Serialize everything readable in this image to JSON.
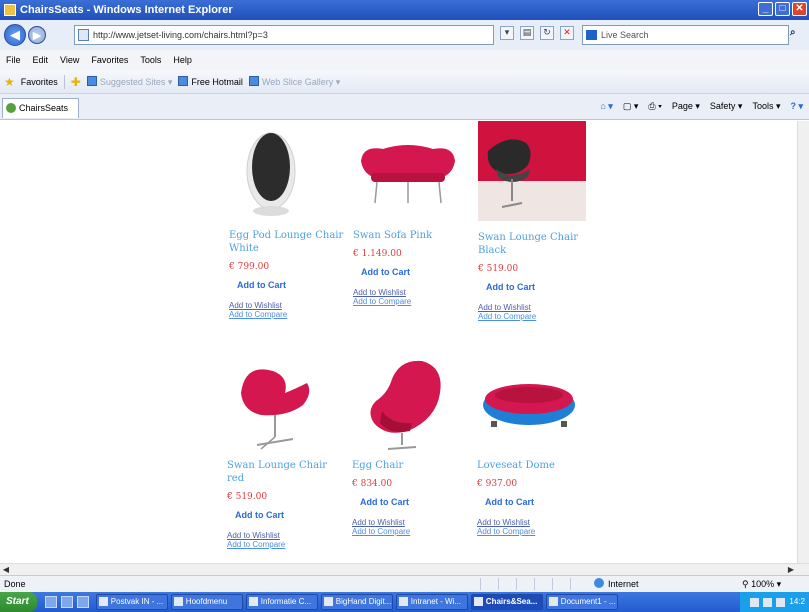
{
  "window": {
    "title": "ChairsSeats - Windows Internet Explorer",
    "buttons": {
      "minimize": "_",
      "maximize": "□",
      "close": "✕"
    }
  },
  "address": {
    "url": "http://www.jetset-living.com/chairs.html?p=3",
    "search_placeholder": "Live Search"
  },
  "menu": [
    "File",
    "Edit",
    "View",
    "Favorites",
    "Tools",
    "Help"
  ],
  "favorites_bar": {
    "favorites_label": "Favorites",
    "suggested": "Suggested Sites ▾",
    "hotmail": "Free Hotmail",
    "webslice": "Web Slice Gallery ▾"
  },
  "tab": {
    "label": "ChairsSeats"
  },
  "command_bar": {
    "page": "Page ▾",
    "safety": "Safety ▾",
    "tools": "Tools ▾"
  },
  "products": [
    {
      "title": "Egg Pod Lounge Chair White",
      "price": "€ 799.00",
      "add_to_cart": "Add to Cart",
      "add_to_wishlist": "Add to Wishlist",
      "add_to_compare": "Add to Compare"
    },
    {
      "title": "Swan Sofa Pink",
      "price": "€ 1.149.00",
      "add_to_cart": "Add to Cart",
      "add_to_wishlist": "Add to Wishlist",
      "add_to_compare": "Add to Compare"
    },
    {
      "title": "Swan Lounge Chair Black",
      "price": "€ 519.00",
      "add_to_cart": "Add to Cart",
      "add_to_wishlist": "Add to Wishlist",
      "add_to_compare": "Add to Compare"
    },
    {
      "title": "Swan Lounge Chair red",
      "price": "€ 519.00",
      "add_to_cart": "Add to Cart",
      "add_to_wishlist": "Add to Wishlist",
      "add_to_compare": "Add to Compare"
    },
    {
      "title": "Egg Chair",
      "price": "€ 834.00",
      "add_to_cart": "Add to Cart",
      "add_to_wishlist": "Add to Wishlist",
      "add_to_compare": "Add to Compare"
    },
    {
      "title": "Loveseat Dome",
      "price": "€ 937.00",
      "add_to_cart": "Add to Cart",
      "add_to_wishlist": "Add to Wishlist",
      "add_to_compare": "Add to Compare"
    }
  ],
  "status": {
    "text": "Done",
    "zone": "Internet",
    "zoom": "100%"
  },
  "taskbar": {
    "start": "Start",
    "tasks": [
      "Postvak IN - ...",
      "Hoofdmenu",
      "Informatie C...",
      "BigHand Digit...",
      "Intranet - Wi...",
      "Chairs&Sea...",
      "Document1 - ..."
    ],
    "clock": "14:2"
  },
  "colors": {
    "title_bar": "#1f4fbb",
    "product_title": "#4da1e3",
    "price": "#e23b3b",
    "add_to_cart": "#2a6bd8",
    "chair_red": "#d4174f"
  }
}
